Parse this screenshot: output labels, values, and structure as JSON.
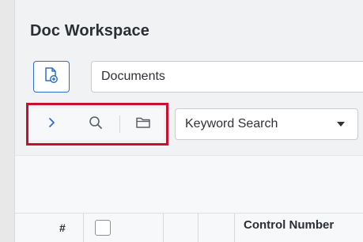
{
  "workspace": {
    "title": "Doc Workspace",
    "new_document_icon": "document-add-icon",
    "document_select_value": "Documents"
  },
  "toolbar": {
    "expand_icon": "chevron-right-icon",
    "search_icon": "search-icon",
    "folder_icon": "folder-icon",
    "search_type_value": "Keyword Search",
    "accent_color": "#2d6fc7",
    "highlight_color": "#c8102e"
  },
  "grid": {
    "columns": [
      "#",
      "",
      "Control Number"
    ]
  }
}
